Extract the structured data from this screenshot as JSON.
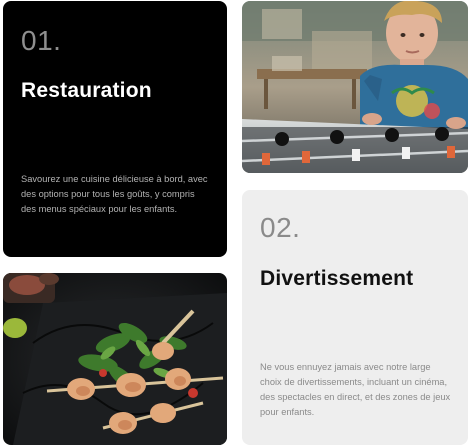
{
  "cards": {
    "restauration": {
      "number": "01.",
      "title": "Restauration",
      "description": "Savourez une cuisine délicieuse à bord, avec des options pour tous les goûts, y compris des menus spéciaux pour les enfants."
    },
    "divertissement": {
      "number": "02.",
      "title": "Divertissement",
      "description": "Ne vous ennuyez jamais avec notre large choix de divertissements, incluant un cinéma, des spectacles en direct, et des zones de jeux pour enfants."
    }
  },
  "images": {
    "boy_foosball": "boy-playing-foosball-photo",
    "food_skewers": "shrimp-skewers-salad-photo"
  },
  "colors": {
    "dark_card": "#000000",
    "light_card": "#eeeeee"
  }
}
